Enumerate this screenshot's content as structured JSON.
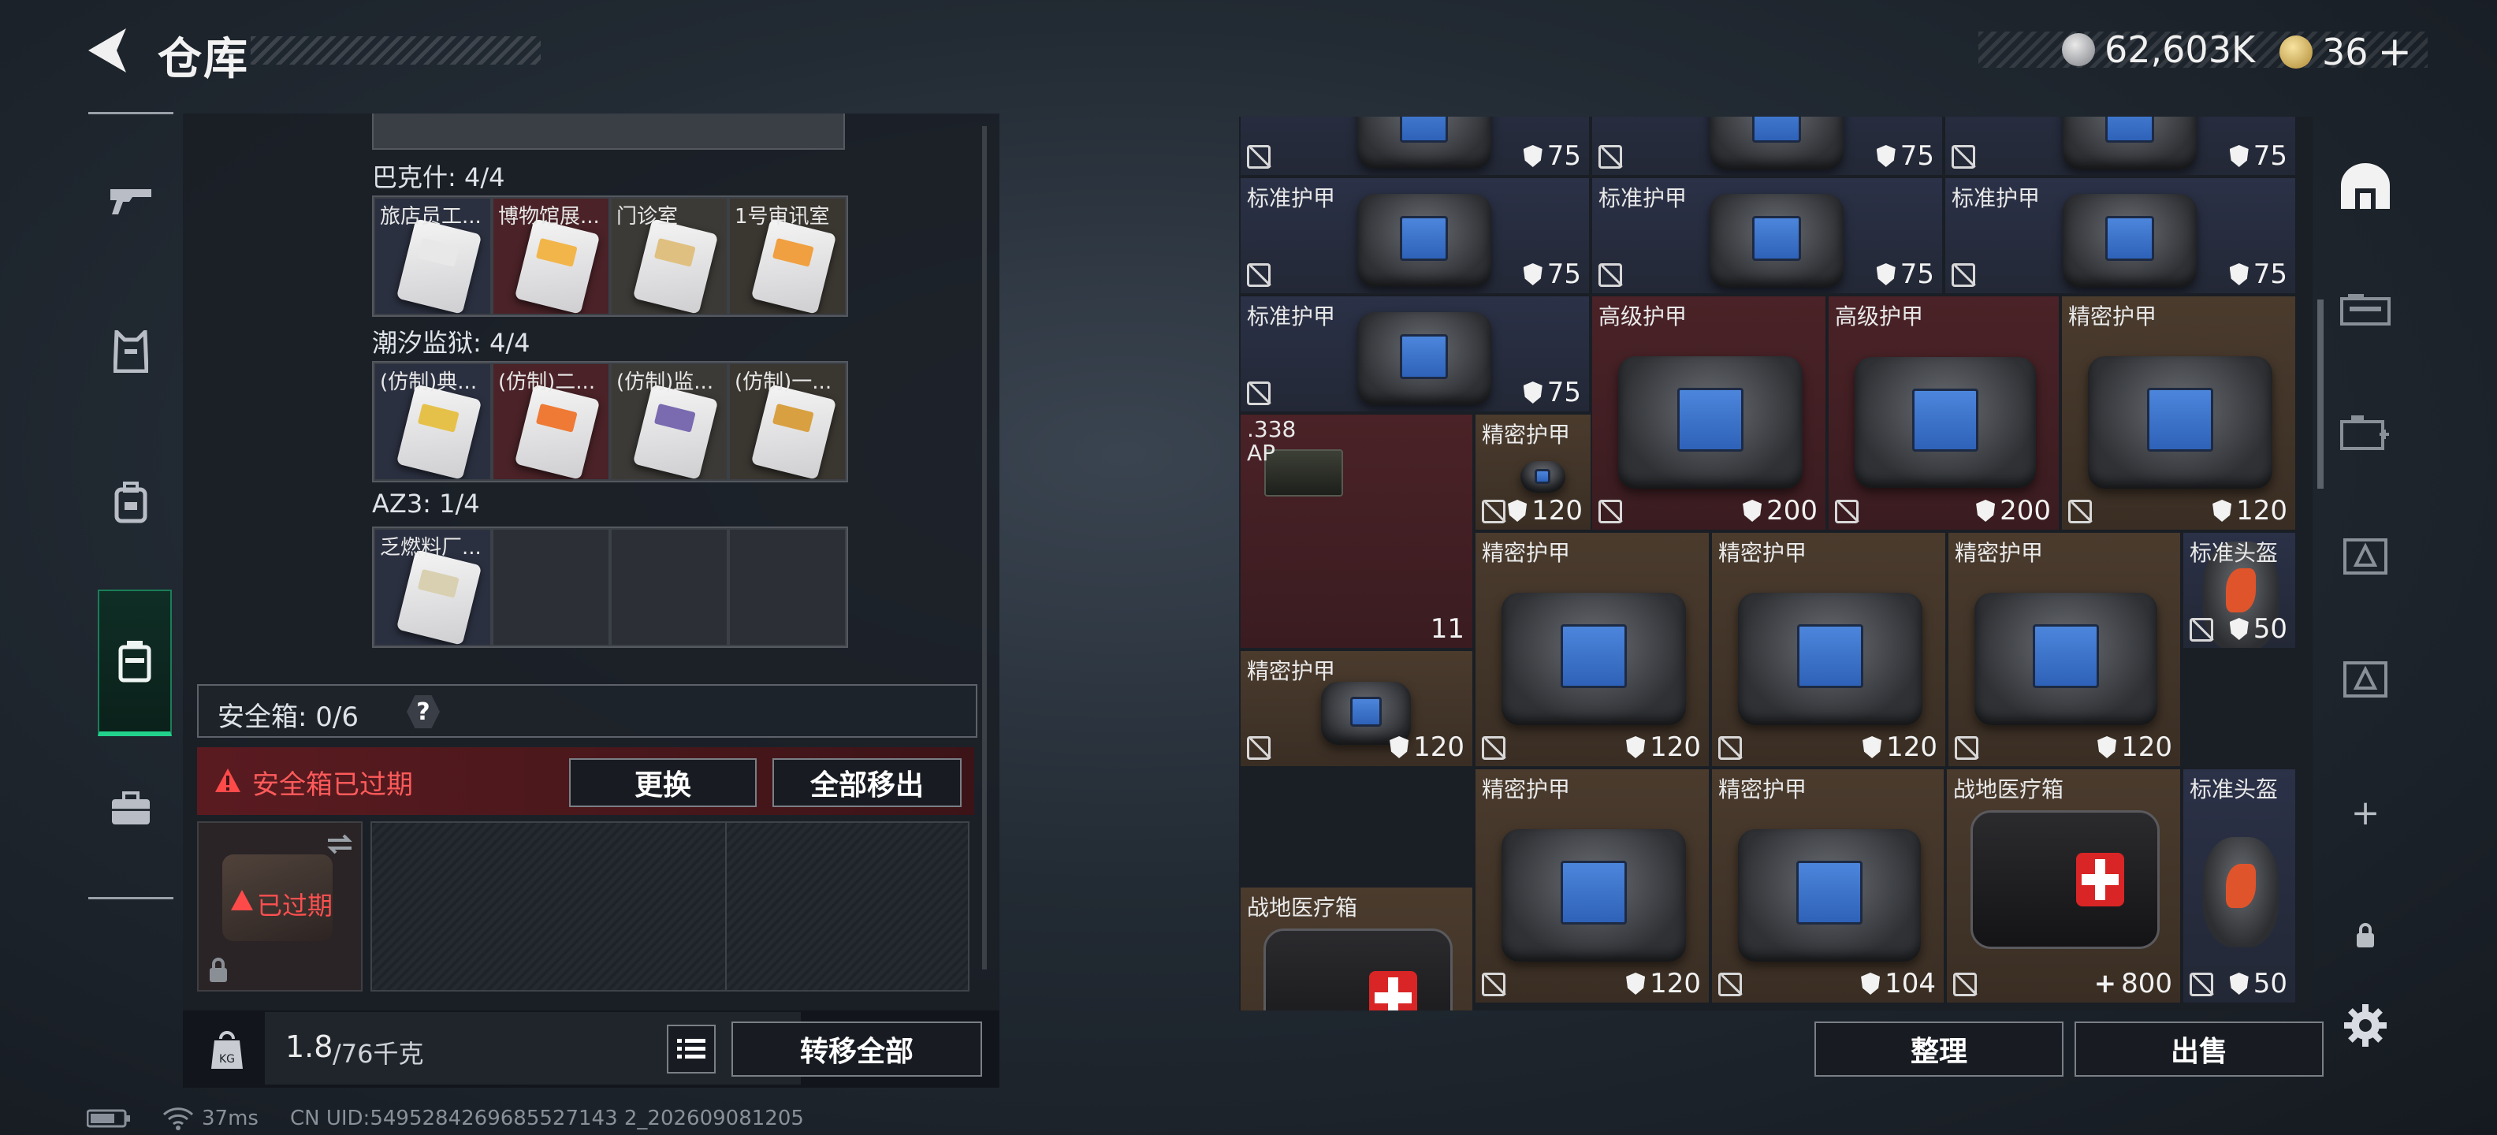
{
  "header": {
    "title": "仓库",
    "currency_silver": "62,603K",
    "currency_gold": "36",
    "gold_add": "+"
  },
  "left_nav": [
    {
      "icon": "gun-icon"
    },
    {
      "icon": "armor-vest-icon"
    },
    {
      "icon": "backpack-icon"
    },
    {
      "icon": "container-icon",
      "active": true
    },
    {
      "icon": "briefcase-icon"
    }
  ],
  "keycards": {
    "groups": [
      {
        "label": "巴克什: 4/4",
        "cards": [
          {
            "name": "旅店员工...",
            "color": "#e8e8e8"
          },
          {
            "name": "博物馆展...",
            "color": "#f2b54a"
          },
          {
            "name": "门诊室",
            "color": "#e0c080"
          },
          {
            "name": "1号审讯室",
            "color": "#f0a040"
          }
        ]
      },
      {
        "label": "潮汐监狱: 4/4",
        "cards": [
          {
            "name": "(仿制)典...",
            "color": "#e6c14a"
          },
          {
            "name": "(仿制)二...",
            "color": "#ef7a35"
          },
          {
            "name": "(仿制)监...",
            "color": "#7a6ab0"
          },
          {
            "name": "(仿制)一...",
            "color": "#d8a040"
          }
        ]
      },
      {
        "label": "AZ3: 1/4",
        "cards": [
          {
            "name": "乏燃料厂...",
            "color": "#d8d0b0"
          }
        ]
      }
    ]
  },
  "safe_box": {
    "label": "安全箱: 0/6",
    "help": "?",
    "warning": "安全箱已过期",
    "replace_btn": "更换",
    "remove_all_btn": "全部移出",
    "expired_tag": "已过期"
  },
  "footer_left": {
    "weight": "1.8",
    "weight_cap": "/76千克",
    "transfer_all": "转移全部"
  },
  "footer_right": {
    "sort_btn": "整理",
    "sell_btn": "出售"
  },
  "status": {
    "ping": "37ms",
    "uid": "CN UID:5495284269685527143 2_202609081205"
  },
  "stash_items": [
    {
      "name": "",
      "stat": "75",
      "bg": "blue",
      "kind": "vest"
    },
    {
      "name": "",
      "stat": "75",
      "bg": "blue",
      "kind": "vest"
    },
    {
      "name": "",
      "stat": "75",
      "bg": "blue",
      "kind": "vest"
    },
    {
      "name": "标准护甲",
      "stat": "75",
      "bg": "blue",
      "kind": "vest"
    },
    {
      "name": "标准护甲",
      "stat": "75",
      "bg": "blue",
      "kind": "vest"
    },
    {
      "name": "标准护甲",
      "stat": "75",
      "bg": "blue",
      "kind": "vest"
    },
    {
      "name": "标准护甲",
      "stat": "75",
      "bg": "blue",
      "kind": "vest"
    },
    {
      "name": "高级护甲",
      "stat": "200",
      "bg": "red",
      "kind": "vest"
    },
    {
      "name": "高级护甲",
      "stat": "200",
      "bg": "red",
      "kind": "vest"
    },
    {
      "name": "精密护甲",
      "stat": "120",
      "bg": "gold",
      "kind": "vest"
    },
    {
      "name": ".338 AP",
      "stat": "11",
      "bg": "red",
      "kind": "ammo"
    },
    {
      "name": "精密护甲",
      "stat": "120",
      "bg": "gold",
      "kind": "vest"
    },
    {
      "name": "精密护甲",
      "stat": "120",
      "bg": "gold",
      "kind": "vest"
    },
    {
      "name": "精密护甲",
      "stat": "120",
      "bg": "gold",
      "kind": "vest"
    },
    {
      "name": "精密护甲",
      "stat": "120",
      "bg": "gold",
      "kind": "vest"
    },
    {
      "name": "标准头盔",
      "stat": "50",
      "bg": "blue",
      "kind": "helmet"
    },
    {
      "name": "精密护甲",
      "stat": "120",
      "bg": "gold",
      "kind": "vest"
    },
    {
      "name": "精密护甲",
      "stat": "120",
      "bg": "gold",
      "kind": "vest"
    },
    {
      "name": "精密护甲",
      "stat": "104",
      "bg": "gold",
      "kind": "vest"
    },
    {
      "name": "战地医疗箱",
      "stat": "800",
      "bg": "gold",
      "kind": "medkit"
    },
    {
      "name": "标准头盔",
      "stat": "50",
      "bg": "blue",
      "kind": "helmet"
    },
    {
      "name": "战地医疗箱",
      "stat": "",
      "bg": "gold",
      "kind": "medkit"
    }
  ]
}
